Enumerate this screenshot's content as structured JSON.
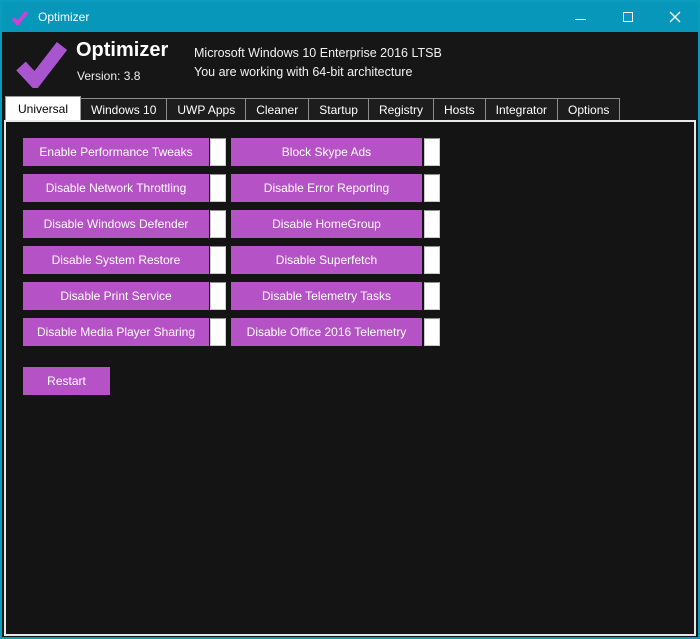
{
  "window": {
    "title": "Optimizer"
  },
  "header": {
    "app_name": "Optimizer",
    "version": "Version: 3.8",
    "os_line": "Microsoft Windows 10 Enterprise 2016 LTSB",
    "arch_line": "You are working with 64-bit architecture"
  },
  "tabs": [
    {
      "label": "Universal",
      "active": true
    },
    {
      "label": "Windows 10",
      "active": false
    },
    {
      "label": "UWP Apps",
      "active": false
    },
    {
      "label": "Cleaner",
      "active": false
    },
    {
      "label": "Startup",
      "active": false
    },
    {
      "label": "Registry",
      "active": false
    },
    {
      "label": "Hosts",
      "active": false
    },
    {
      "label": "Integrator",
      "active": false
    },
    {
      "label": "Options",
      "active": false
    }
  ],
  "universal_tab": {
    "toggle_rows": [
      {
        "left": "Enable Performance Tweaks",
        "right": "Block Skype Ads"
      },
      {
        "left": "Disable Network Throttling",
        "right": "Disable Error Reporting"
      },
      {
        "left": "Disable Windows Defender",
        "right": "Disable HomeGroup"
      },
      {
        "left": "Disable System Restore",
        "right": "Disable Superfetch"
      },
      {
        "left": "Disable Print Service",
        "right": "Disable Telemetry Tasks"
      },
      {
        "left": "Disable Media Player Sharing",
        "right": "Disable Office 2016 Telemetry"
      }
    ],
    "restart_label": "Restart"
  },
  "icons": {
    "titlebar_logo": "checkmark-icon",
    "header_logo": "checkmark-icon",
    "minimize": "minimize-icon",
    "maximize": "maximize-icon",
    "close": "close-icon"
  },
  "colors": {
    "titlebar": "#0697ba",
    "window_border": "#0a9cbd",
    "background": "#161616",
    "page_background": "#141414",
    "button_accent": "#b553c6",
    "logo_purple": "#aa55d0",
    "titlebar_check_magenta": "#d23fd6"
  }
}
